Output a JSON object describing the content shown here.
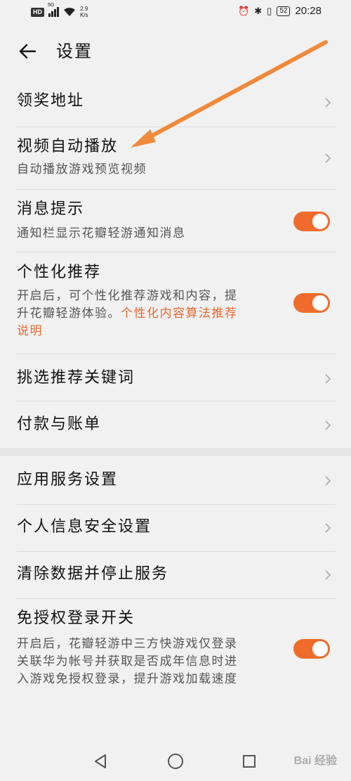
{
  "status_bar": {
    "badge": "HD",
    "network": "5G",
    "speed_value": "2.9",
    "speed_unit": "K/s",
    "battery": "52",
    "time": "20:28"
  },
  "header": {
    "title": "设置"
  },
  "items": [
    {
      "title": "领奖地址"
    },
    {
      "title": "视频自动播放",
      "subtitle": "自动播放游戏预览视频"
    },
    {
      "title": "消息提示",
      "subtitle": "通知栏显示花瓣轻游通知消息",
      "toggle_on": true
    },
    {
      "title": "个性化推荐",
      "subtitle_line1": "开启后，可个性化推荐游戏和内容，提",
      "subtitle_line2": "升花瓣轻游体验。",
      "link_part1": "个性化内容算法推荐",
      "link_part2": "说明",
      "toggle_on": true
    },
    {
      "title": "挑选推荐关键词"
    },
    {
      "title": "付款与账单"
    },
    {
      "title": "应用服务设置"
    },
    {
      "title": "个人信息安全设置"
    },
    {
      "title": "清除数据并停止服务"
    },
    {
      "title": "免授权登录开关",
      "subtitle_line1": "开启后，花瓣轻游中三方快游戏仅登录",
      "subtitle_line2": "关联华为帐号并获取是否成年信息时进",
      "subtitle_line3": "入游戏免授权登录，提升游戏加载速度",
      "toggle_on": true
    }
  ],
  "watermark": "Bai 经验",
  "colors": {
    "accent": "#ef6c2d",
    "link": "#e8692f",
    "background": "#f1f1f1"
  }
}
